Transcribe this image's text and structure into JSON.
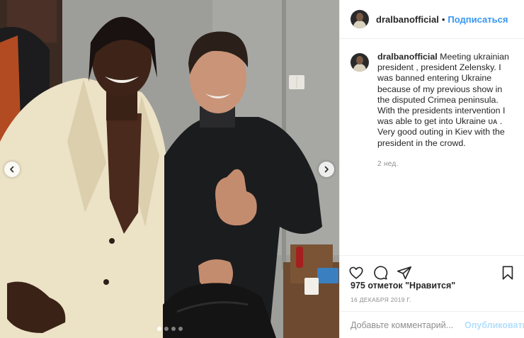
{
  "post": {
    "username": "dralbanofficial",
    "follow_label": "Подписаться",
    "header_separator": "•",
    "caption": {
      "username": "dralbanofficial",
      "text": "Meeting ukrainian president , president Zelensky. I was banned entering Ukraine because of my previous show in the disputed Crimea peninsula. With the presidents intervention I was able to get into Ukraine ᴜᴀ . Very good outing in Kiev with the president in the crowd.",
      "time": "2 нед."
    },
    "likes": "975 отметок \"Нравится\"",
    "date": "16 ДЕКАБРЯ 2019 Г.",
    "comment": {
      "placeholder": "Добавьте комментарий...",
      "publish_label": "Опубликовать"
    },
    "carousel": {
      "slide_count": 4,
      "active_slide": 1
    }
  },
  "colors": {
    "link_blue": "#3897f0",
    "publish_disabled": "#b2dffc",
    "secondary_text": "#8e8e8e",
    "border": "#efefef"
  },
  "icons": [
    "chevron-left-icon",
    "chevron-right-icon",
    "heart-icon",
    "comment-icon",
    "share-icon",
    "bookmark-icon"
  ]
}
